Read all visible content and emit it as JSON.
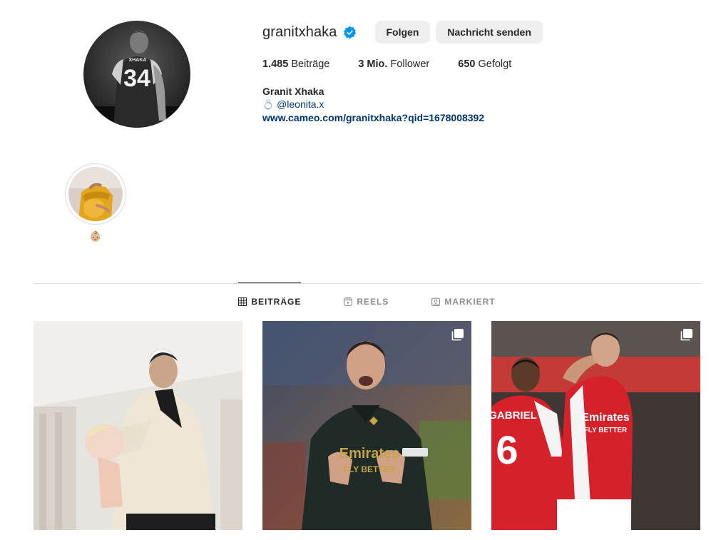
{
  "profile": {
    "username": "granitxhaka",
    "verified": true,
    "follow_label": "Folgen",
    "message_label": "Nachricht senden",
    "avatar_icon": "profile-photo",
    "jersey_name": "XHAKA",
    "jersey_number": "34"
  },
  "stats": {
    "posts_num": "1.485",
    "posts_label": "Beiträge",
    "followers_num": "3 Mio.",
    "followers_label": "Follower",
    "following_num": "650",
    "following_label": "Gefolgt"
  },
  "bio": {
    "full_name": "Granit Xhaka",
    "ring_emoji": "💍",
    "mention": "@leonita.x",
    "link": "www.cameo.com/granitxhaka?qid=1678008392"
  },
  "highlights": [
    {
      "label": "👶🏼"
    }
  ],
  "tabs": [
    {
      "label": "BEITRÄGE",
      "icon": "grid-icon",
      "active": true
    },
    {
      "label": "REELS",
      "icon": "reels-icon",
      "active": false
    },
    {
      "label": "MARKIERT",
      "icon": "tagged-icon",
      "active": false
    }
  ],
  "posts": [
    {
      "kind": "photo",
      "multi": false
    },
    {
      "kind": "photo",
      "multi": true
    },
    {
      "kind": "photo",
      "multi": true,
      "shirt_name": "GABRIEL",
      "shirt_number": "6",
      "sponsor": "Emirates FLY BETTER"
    }
  ],
  "colors": {
    "link": "#00376b",
    "verified": "#0095f6",
    "button_bg": "#efefef",
    "arsenal_red": "#d6202a"
  }
}
